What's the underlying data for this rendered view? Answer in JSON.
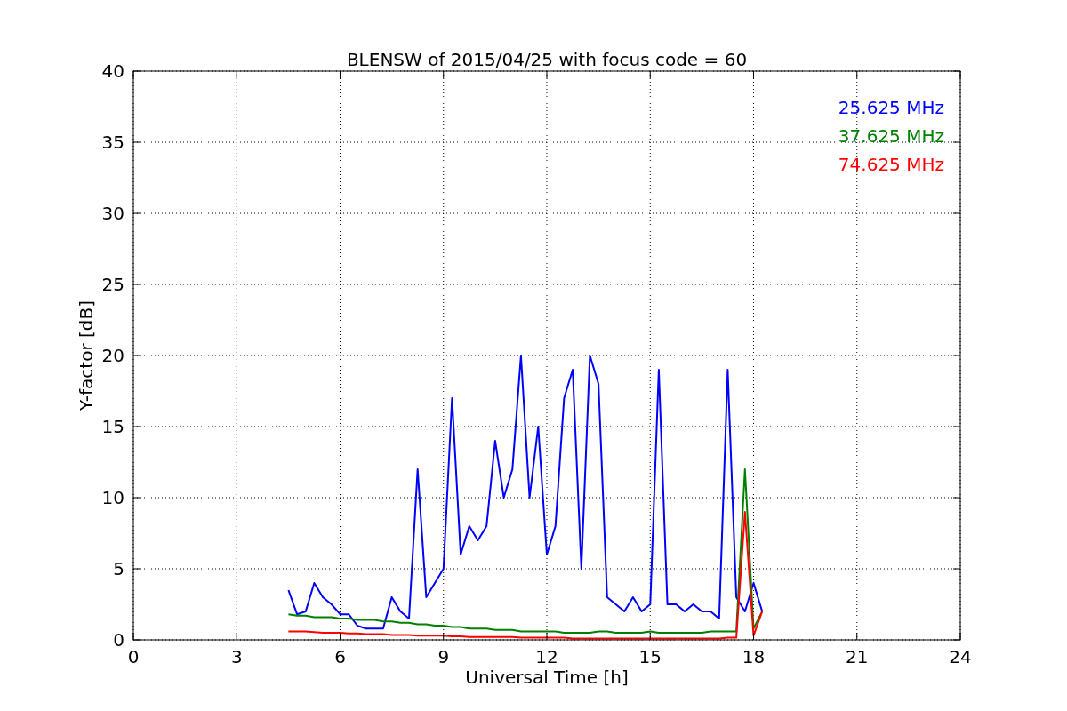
{
  "chart_data": {
    "type": "line",
    "title": "BLENSW of 2015/04/25 with focus code = 60",
    "xlabel": "Universal Time [h]",
    "ylabel": "Y-factor [dB]",
    "x": [
      4.5,
      4.75,
      5,
      5.25,
      5.5,
      5.75,
      6,
      6.25,
      6.5,
      6.75,
      7,
      7.25,
      7.5,
      7.75,
      8,
      8.25,
      8.5,
      8.75,
      9,
      9.25,
      9.5,
      9.75,
      10,
      10.25,
      10.5,
      10.75,
      11,
      11.25,
      11.5,
      11.75,
      12,
      12.25,
      12.5,
      12.75,
      13,
      13.25,
      13.5,
      13.75,
      14,
      14.25,
      14.5,
      14.75,
      15,
      15.25,
      15.5,
      15.75,
      16,
      16.25,
      16.5,
      16.75,
      17,
      17.25,
      17.5,
      17.75,
      18,
      18.25
    ],
    "series": [
      {
        "name": "25.625 MHz",
        "color": "#0000ff",
        "values": [
          3.5,
          1.8,
          2,
          4,
          3,
          2.5,
          1.8,
          1.8,
          1,
          0.8,
          0.8,
          0.8,
          3,
          2,
          1.5,
          12,
          3,
          4,
          5,
          17,
          6,
          8,
          7,
          8,
          14,
          10,
          12,
          20,
          10,
          15,
          6,
          8,
          17,
          19,
          5,
          20,
          18,
          3,
          2.5,
          2,
          3,
          2,
          2.5,
          19,
          2.5,
          2.5,
          2,
          2.5,
          2,
          2,
          1.5,
          19,
          3,
          2,
          4,
          2
        ]
      },
      {
        "name": "37.625 MHz",
        "color": "#008000",
        "values": [
          1.8,
          1.7,
          1.7,
          1.6,
          1.6,
          1.6,
          1.5,
          1.5,
          1.4,
          1.4,
          1.4,
          1.3,
          1.3,
          1.2,
          1.2,
          1.1,
          1.1,
          1,
          1,
          0.9,
          0.9,
          0.8,
          0.8,
          0.8,
          0.7,
          0.7,
          0.7,
          0.6,
          0.6,
          0.6,
          0.6,
          0.6,
          0.5,
          0.5,
          0.5,
          0.5,
          0.6,
          0.6,
          0.5,
          0.5,
          0.5,
          0.5,
          0.6,
          0.5,
          0.5,
          0.5,
          0.5,
          0.5,
          0.5,
          0.6,
          0.6,
          0.6,
          0.6,
          12,
          0.8,
          2
        ]
      },
      {
        "name": "74.625 MHz",
        "color": "#ff0000",
        "values": [
          0.6,
          0.6,
          0.6,
          0.55,
          0.5,
          0.5,
          0.5,
          0.45,
          0.45,
          0.4,
          0.4,
          0.4,
          0.35,
          0.35,
          0.35,
          0.3,
          0.3,
          0.3,
          0.3,
          0.25,
          0.25,
          0.2,
          0.2,
          0.2,
          0.2,
          0.2,
          0.2,
          0.15,
          0.15,
          0.15,
          0.15,
          0.15,
          0.15,
          0.1,
          0.1,
          0.1,
          0.1,
          0.1,
          0.1,
          0.1,
          0.1,
          0.1,
          0.1,
          0.1,
          0.1,
          0.1,
          0.1,
          0.1,
          0.1,
          0.1,
          0.1,
          0.15,
          0.15,
          9,
          0.3,
          2
        ]
      }
    ],
    "grid": true,
    "xlim": [
      0,
      24
    ],
    "ylim": [
      0,
      40
    ],
    "xticks": [
      0,
      3,
      6,
      9,
      12,
      15,
      18,
      21,
      24
    ],
    "yticks": [
      0,
      5,
      10,
      15,
      20,
      25,
      30,
      35,
      40
    ]
  }
}
